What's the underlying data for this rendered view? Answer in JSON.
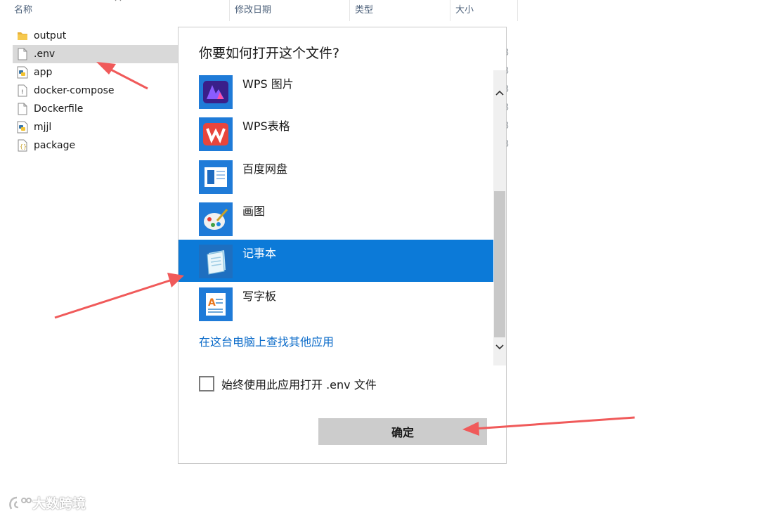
{
  "explorer": {
    "columns": [
      "名称",
      "修改日期",
      "类型",
      "大小"
    ],
    "files": [
      {
        "name": "output",
        "icon": "folder-icon"
      },
      {
        "name": ".env",
        "icon": "file-icon",
        "selected": true
      },
      {
        "name": "app",
        "icon": "python-file-icon"
      },
      {
        "name": "docker-compose",
        "icon": "yaml-file-icon"
      },
      {
        "name": "Dockerfile",
        "icon": "file-icon"
      },
      {
        "name": "mjjl",
        "icon": "python-file-icon"
      },
      {
        "name": "package",
        "icon": "json-file-icon"
      }
    ],
    "size_suffix": "3"
  },
  "dialog": {
    "title": "你要如何打开这个文件?",
    "apps": [
      {
        "label": "WPS 图片",
        "icon": "wps-photo-icon"
      },
      {
        "label": "WPS表格",
        "icon": "wps-spreadsheet-icon"
      },
      {
        "label": "百度网盘",
        "icon": "baidu-netdisk-icon"
      },
      {
        "label": "画图",
        "icon": "paint-icon"
      },
      {
        "label": "记事本",
        "icon": "notepad-icon",
        "selected": true
      },
      {
        "label": "写字板",
        "icon": "wordpad-icon"
      }
    ],
    "more_apps_link": "在这台电脑上查找其他应用",
    "always_use_label": "始终使用此应用打开 .env 文件",
    "always_use_checked": false,
    "ok_label": "确定"
  },
  "colors": {
    "selection_blue": "#0c7ad8",
    "link_blue": "#0b6bc9",
    "annotation_arrow": "#f05a5a"
  },
  "watermark": "大数跨境"
}
